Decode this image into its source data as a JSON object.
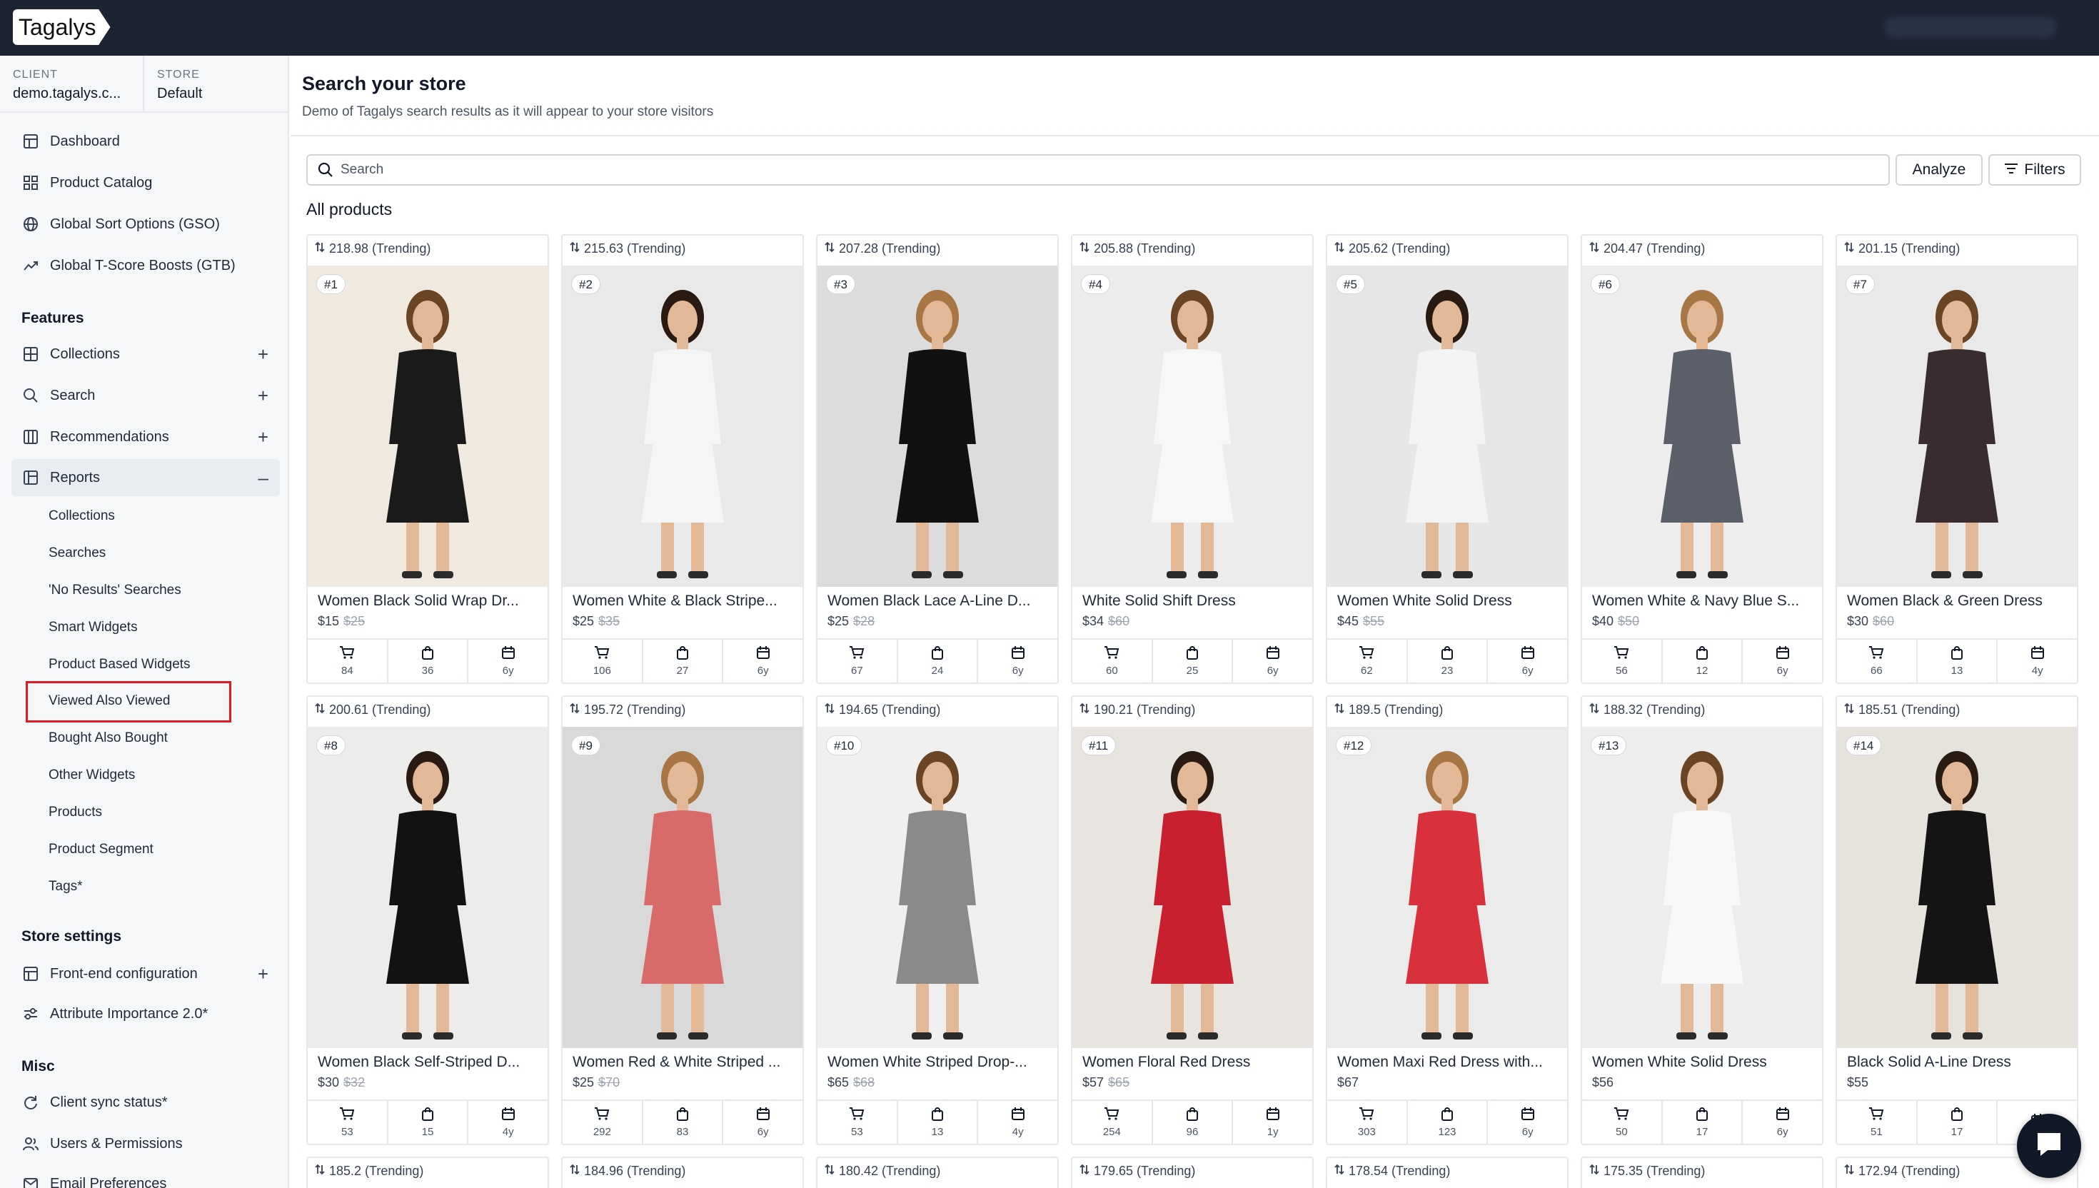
{
  "app": {
    "logo_text": "Tagalys"
  },
  "context": {
    "client_label": "CLIENT",
    "client_value": "demo.tagalys.c...",
    "store_label": "STORE",
    "store_value": "Default"
  },
  "nav": {
    "dashboard": "Dashboard",
    "product_catalog": "Product Catalog",
    "gso": "Global Sort Options (GSO)",
    "gtb": "Global T-Score Boosts (GTB)",
    "features_heading": "Features",
    "collections": "Collections",
    "search": "Search",
    "recommendations": "Recommendations",
    "reports": "Reports",
    "reports_sub": [
      "Collections",
      "Searches",
      "'No Results' Searches",
      "Smart Widgets",
      "Product Based Widgets",
      "Viewed Also Viewed",
      "Bought Also Bought",
      "Other Widgets",
      "Products",
      "Product Segment",
      "Tags*"
    ],
    "store_settings_heading": "Store settings",
    "frontend_config": "Front-end configuration",
    "attribute_importance": "Attribute Importance 2.0*",
    "misc_heading": "Misc",
    "client_sync": "Client sync status*",
    "users_permissions": "Users & Permissions",
    "email_prefs": "Email Preferences"
  },
  "page": {
    "title": "Search your store",
    "subtitle": "Demo of Tagalys search results as it will appear to your store visitors",
    "search_placeholder": "Search",
    "analyze_label": "Analyze",
    "filters_label": "Filters",
    "section_label": "All products"
  },
  "products": [
    {
      "score": "218.98 (Trending)",
      "rank": "#1",
      "name": "Women Black Solid Wrap Dr...",
      "price": "$15",
      "old_price": "$25",
      "carts": "84",
      "bought": "36",
      "age": "6y",
      "dress_color": "#1a1a1a",
      "bg_color": "#efe9df"
    },
    {
      "score": "215.63 (Trending)",
      "rank": "#2",
      "name": "Women White & Black Stripe...",
      "price": "$25",
      "old_price": "$35",
      "carts": "106",
      "bought": "27",
      "age": "6y",
      "dress_color": "#f5f5f5",
      "bg_color": "#e9e9e9"
    },
    {
      "score": "207.28 (Trending)",
      "rank": "#3",
      "name": "Women Black Lace A-Line D...",
      "price": "$25",
      "old_price": "$28",
      "carts": "67",
      "bought": "24",
      "age": "6y",
      "dress_color": "#111111",
      "bg_color": "#dcdcdc"
    },
    {
      "score": "205.88 (Trending)",
      "rank": "#4",
      "name": "White Solid Shift Dress",
      "price": "$34",
      "old_price": "$60",
      "carts": "60",
      "bought": "25",
      "age": "6y",
      "dress_color": "#f7f7f7",
      "bg_color": "#ececec"
    },
    {
      "score": "205.62 (Trending)",
      "rank": "#5",
      "name": "Women White Solid Dress",
      "price": "$45",
      "old_price": "$55",
      "carts": "62",
      "bought": "23",
      "age": "6y",
      "dress_color": "#f4f4f4",
      "bg_color": "#e6e6e6"
    },
    {
      "score": "204.47 (Trending)",
      "rank": "#6",
      "name": "Women White & Navy Blue S...",
      "price": "$40",
      "old_price": "$50",
      "carts": "56",
      "bought": "12",
      "age": "6y",
      "dress_color": "#5a5f6a",
      "bg_color": "#ededed"
    },
    {
      "score": "201.15 (Trending)",
      "rank": "#7",
      "name": "Women Black & Green Dress",
      "price": "$30",
      "old_price": "$60",
      "carts": "66",
      "bought": "13",
      "age": "4y",
      "dress_color": "#3a2b2e",
      "bg_color": "#e9e9e9"
    },
    {
      "score": "200.61 (Trending)",
      "rank": "#8",
      "name": "Women Black Self-Striped D...",
      "price": "$30",
      "old_price": "$32",
      "carts": "53",
      "bought": "15",
      "age": "4y",
      "dress_color": "#121212",
      "bg_color": "#ececea"
    },
    {
      "score": "195.72 (Trending)",
      "rank": "#9",
      "name": "Women Red & White Striped ...",
      "price": "$25",
      "old_price": "$70",
      "carts": "292",
      "bought": "83",
      "age": "6y",
      "dress_color": "#d96a6a",
      "bg_color": "#d9d9d9"
    },
    {
      "score": "194.65 (Trending)",
      "rank": "#10",
      "name": "Women White Striped Drop-...",
      "price": "$65",
      "old_price": "$68",
      "carts": "53",
      "bought": "13",
      "age": "4y",
      "dress_color": "#8a8a8a",
      "bg_color": "#f0f0f0"
    },
    {
      "score": "190.21 (Trending)",
      "rank": "#11",
      "name": "Women Floral Red Dress",
      "price": "$57",
      "old_price": "$65",
      "carts": "254",
      "bought": "96",
      "age": "1y",
      "dress_color": "#c8202e",
      "bg_color": "#e8e4df"
    },
    {
      "score": "189.5 (Trending)",
      "rank": "#12",
      "name": "Women Maxi Red Dress with...",
      "price": "$67",
      "old_price": "",
      "carts": "303",
      "bought": "123",
      "age": "6y",
      "dress_color": "#d8313b",
      "bg_color": "#ebebeb"
    },
    {
      "score": "188.32 (Trending)",
      "rank": "#13",
      "name": "Women White Solid Dress",
      "price": "$56",
      "old_price": "",
      "carts": "50",
      "bought": "17",
      "age": "6y",
      "dress_color": "#f8f8f8",
      "bg_color": "#ededed"
    },
    {
      "score": "185.51 (Trending)",
      "rank": "#14",
      "name": "Black Solid A-Line Dress",
      "price": "$55",
      "old_price": "",
      "carts": "51",
      "bought": "17",
      "age": "",
      "dress_color": "#141414",
      "bg_color": "#e6e2dc"
    }
  ],
  "next_row_scores": [
    "185.2 (Trending)",
    "184.96 (Trending)",
    "180.42 (Trending)",
    "179.65 (Trending)",
    "178.54 (Trending)",
    "175.35 (Trending)",
    "172.94 (Trending)"
  ]
}
